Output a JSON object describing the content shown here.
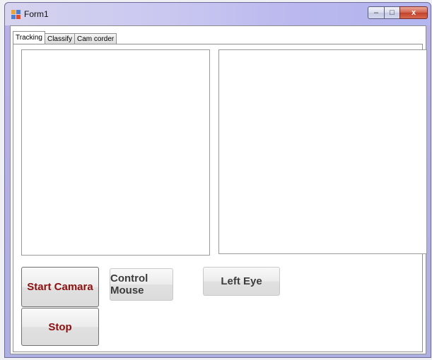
{
  "window": {
    "title": "Form1"
  },
  "caption_buttons": {
    "minimize": "–",
    "maximize": "□",
    "close": "x"
  },
  "tabs": [
    {
      "label": "Tracking",
      "active": true
    },
    {
      "label": "Classify",
      "active": false
    },
    {
      "label": "Cam corder",
      "active": false
    }
  ],
  "buttons": {
    "start": "Start Camara",
    "control_mouse": "Control Mouse",
    "left_eye": "Left Eye",
    "stop": "Stop"
  },
  "colors": {
    "button_text_accent": "#8b1010",
    "close_button": "#c7452e"
  }
}
